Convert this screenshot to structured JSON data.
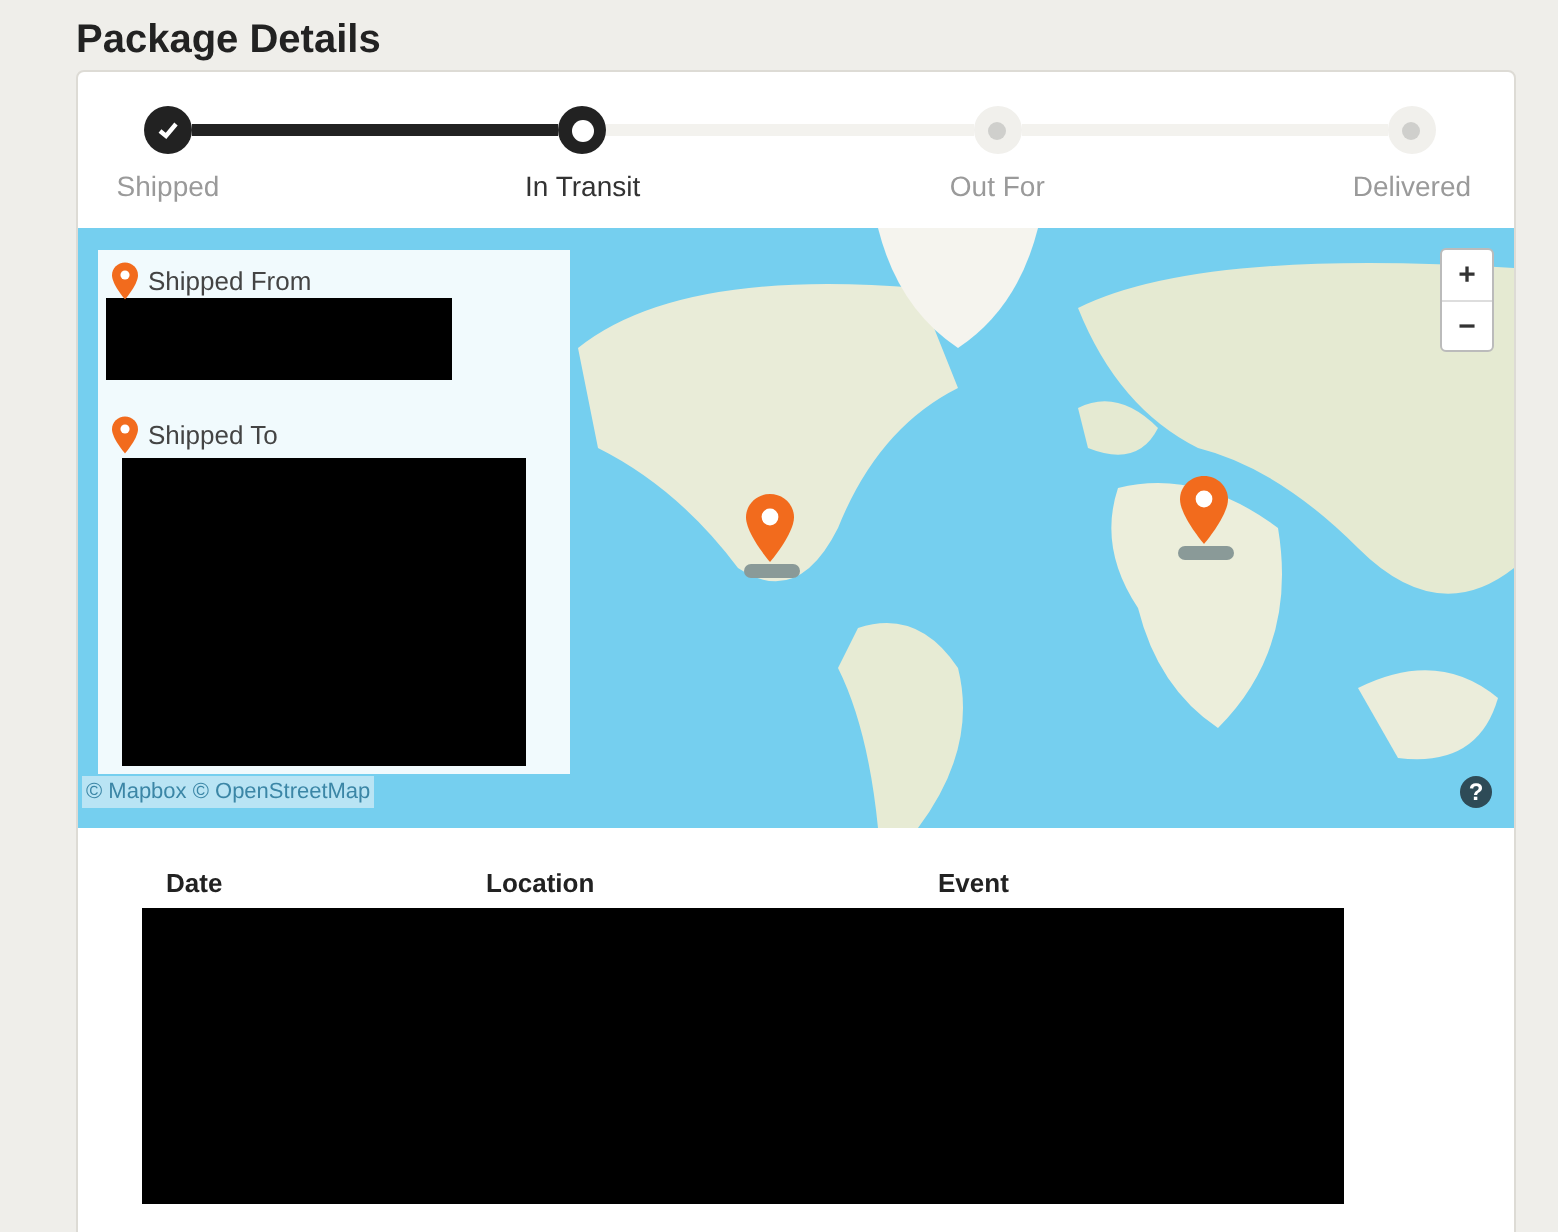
{
  "title": "Package Details",
  "steps": [
    {
      "label": "Shipped",
      "kind": "done"
    },
    {
      "label": "In Transit",
      "kind": "current"
    },
    {
      "label": "Out For",
      "kind": "pending"
    },
    {
      "label": "Delivered",
      "kind": "pending"
    }
  ],
  "map": {
    "from_label": "Shipped From",
    "to_label": "Shipped To",
    "zoom_buttons": [
      "+",
      "−"
    ],
    "help": "?",
    "attribution": "© Mapbox © OpenStreetMap"
  },
  "table": {
    "columns": [
      "Date",
      "Location",
      "Event"
    ]
  }
}
